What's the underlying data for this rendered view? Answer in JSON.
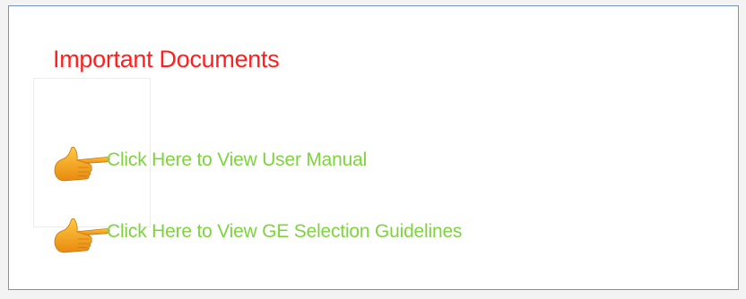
{
  "section": {
    "title": "Important Documents"
  },
  "links": [
    {
      "label": "Click Here to View User Manual",
      "icon": "pointing-hand-icon"
    },
    {
      "label": "Click Here to View GE Selection Guidelines",
      "icon": "pointing-hand-icon"
    }
  ],
  "colors": {
    "title": "#ff1f1f",
    "link": "#7fd33f",
    "border": "#7393c2",
    "hand": "#f6a91c"
  }
}
